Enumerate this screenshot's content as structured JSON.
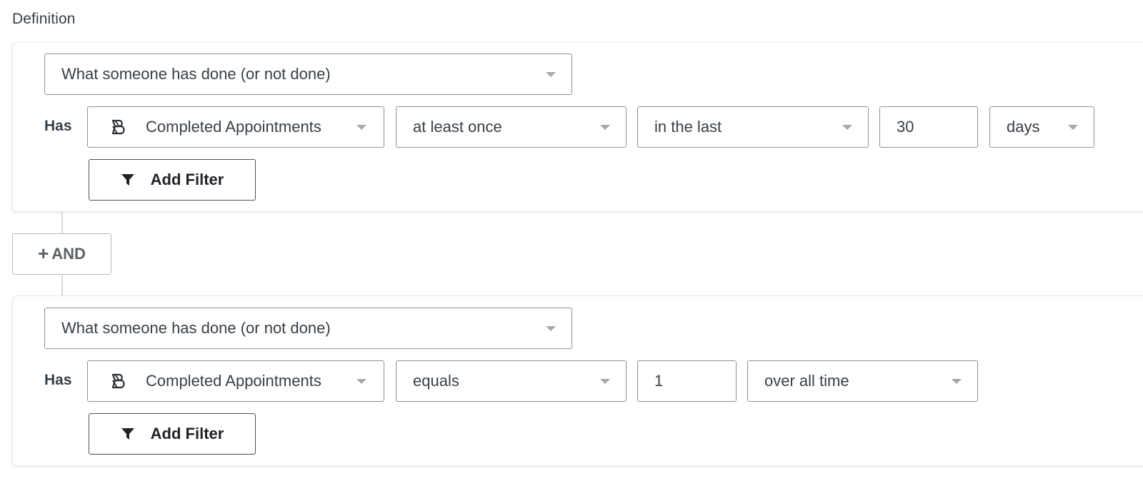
{
  "section_title": "Definition",
  "conditions": [
    {
      "type_select": {
        "value": "What someone has done (or not done)",
        "icon": "caret-down-icon"
      },
      "has_label": "Has",
      "event_select": {
        "value": "Completed Appointments",
        "icon": "integration-logo-icon"
      },
      "operator_select": {
        "value": "at least once"
      },
      "timeframe_select": {
        "value": "in the last"
      },
      "quantity_input": {
        "value": "30"
      },
      "unit_select": {
        "value": "days"
      },
      "add_filter_button": {
        "label": "Add Filter",
        "icon": "funnel-icon"
      }
    },
    {
      "type_select": {
        "value": "What someone has done (or not done)",
        "icon": "caret-down-icon"
      },
      "has_label": "Has",
      "event_select": {
        "value": "Completed Appointments",
        "icon": "integration-logo-icon"
      },
      "operator_select": {
        "value": "equals"
      },
      "count_input": {
        "value": "1"
      },
      "timeframe_select": {
        "value": "over all time"
      },
      "add_filter_button": {
        "label": "Add Filter",
        "icon": "funnel-icon"
      }
    }
  ],
  "and_button": {
    "plus": "+",
    "label": "AND"
  },
  "colors": {
    "text": "#373f47",
    "border": "#8a9096",
    "caret": "#a3a8ad",
    "button_border": "#4a4f55",
    "and_text": "#5b6167"
  }
}
